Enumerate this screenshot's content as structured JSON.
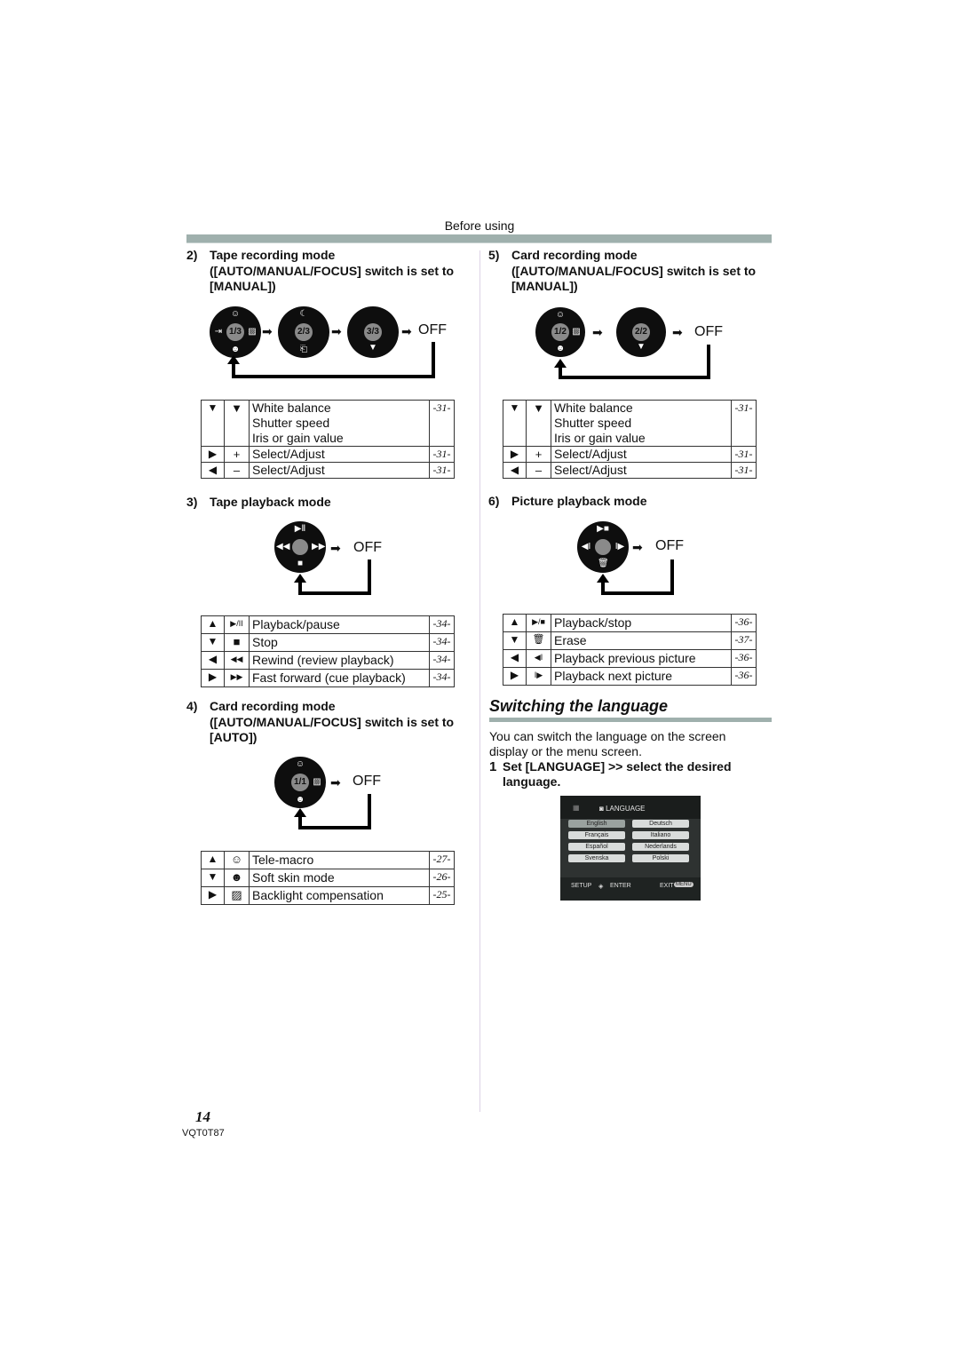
{
  "header": {
    "section": "Before using"
  },
  "sections": {
    "tape_rec_manual": {
      "num": "2)",
      "title_lines": [
        "Tape recording mode",
        "([AUTO/MANUAL/FOCUS] switch is set to",
        "[MANUAL])"
      ],
      "diagram": {
        "steps": [
          "1/3",
          "2/3",
          "3/3"
        ],
        "end": "OFF",
        "step1_icons": [
          "tele-macro-icon",
          "fade-icon",
          "backlight-icon",
          "soft-skin-icon"
        ],
        "step2_icons": [
          "low-light-icon",
          "help-icon"
        ],
        "step3_icons": [
          "down-arrow-icon"
        ]
      },
      "rows": [
        {
          "key": "▼",
          "icon": "▼",
          "desc": [
            "White balance",
            "Shutter speed",
            "Iris or gain value"
          ],
          "page": "-31-"
        },
        {
          "key": "▶",
          "icon": "+",
          "desc": [
            "Select/Adjust"
          ],
          "page": "-31-"
        },
        {
          "key": "◀",
          "icon": "–",
          "desc": [
            "Select/Adjust"
          ],
          "page": "-31-"
        }
      ]
    },
    "tape_playback": {
      "num": "3)",
      "title_lines": [
        "Tape playback mode"
      ],
      "diagram": {
        "end": "OFF"
      },
      "rows": [
        {
          "key": "▲",
          "icon": "▶/II",
          "desc": [
            "Playback/pause"
          ],
          "page": "-34-"
        },
        {
          "key": "▼",
          "icon": "■",
          "desc": [
            "Stop"
          ],
          "page": "-34-"
        },
        {
          "key": "◀",
          "icon": "◀◀",
          "desc": [
            "Rewind (review playback)"
          ],
          "page": "-34-"
        },
        {
          "key": "▶",
          "icon": "▶▶",
          "desc": [
            "Fast forward (cue playback)"
          ],
          "page": "-34-"
        }
      ]
    },
    "card_rec_auto": {
      "num": "4)",
      "title_lines": [
        "Card recording mode",
        "([AUTO/MANUAL/FOCUS] switch is set to",
        "[AUTO])"
      ],
      "diagram": {
        "steps": [
          "1/1"
        ],
        "end": "OFF"
      },
      "rows": [
        {
          "key": "▲",
          "icon": "☺",
          "desc": [
            "Tele-macro"
          ],
          "page": "-27-"
        },
        {
          "key": "▼",
          "icon": "☻",
          "desc": [
            "Soft skin mode"
          ],
          "page": "-26-"
        },
        {
          "key": "▶",
          "icon": "▨",
          "desc": [
            "Backlight compensation"
          ],
          "page": "-25-"
        }
      ]
    },
    "card_rec_manual": {
      "num": "5)",
      "title_lines": [
        "Card recording mode",
        "([AUTO/MANUAL/FOCUS] switch is set to",
        "[MANUAL])"
      ],
      "diagram": {
        "steps": [
          "1/2",
          "2/2"
        ],
        "end": "OFF"
      },
      "rows": [
        {
          "key": "▼",
          "icon": "▼",
          "desc": [
            "White balance",
            "Shutter speed",
            "Iris or gain value"
          ],
          "page": "-31-"
        },
        {
          "key": "▶",
          "icon": "+",
          "desc": [
            "Select/Adjust"
          ],
          "page": "-31-"
        },
        {
          "key": "◀",
          "icon": "–",
          "desc": [
            "Select/Adjust"
          ],
          "page": "-31-"
        }
      ]
    },
    "picture_playback": {
      "num": "6)",
      "title_lines": [
        "Picture playback mode"
      ],
      "diagram": {
        "end": "OFF"
      },
      "rows": [
        {
          "key": "▲",
          "icon": "▶/■",
          "desc": [
            "Playback/stop"
          ],
          "page": "-36-"
        },
        {
          "key": "▼",
          "icon": "🗑",
          "desc": [
            "Erase"
          ],
          "page": "-37-"
        },
        {
          "key": "◀",
          "icon": "◀I",
          "desc": [
            "Playback previous picture"
          ],
          "page": "-36-"
        },
        {
          "key": "▶",
          "icon": "I▶",
          "desc": [
            "Playback next picture"
          ],
          "page": "-36-"
        }
      ]
    }
  },
  "language": {
    "heading": "Switching the language",
    "intro_lines": [
      "You can switch the language on the screen",
      "display or the menu screen."
    ],
    "step_num": "1",
    "step_lines": [
      "Set [LANGUAGE] >> select the desired",
      "language."
    ],
    "lcd": {
      "title": "LANGUAGE",
      "options": [
        "English",
        "Deutsch",
        "Français",
        "Italiano",
        "Español",
        "Nederlands",
        "Svenska",
        "Polski"
      ],
      "selected": "English",
      "footer_left": "SETUP",
      "footer_mid": "ENTER",
      "footer_right": "EXIT",
      "menu_badge": "MENU"
    }
  },
  "footer": {
    "page_number": "14",
    "model_code": "VQT0T87"
  }
}
